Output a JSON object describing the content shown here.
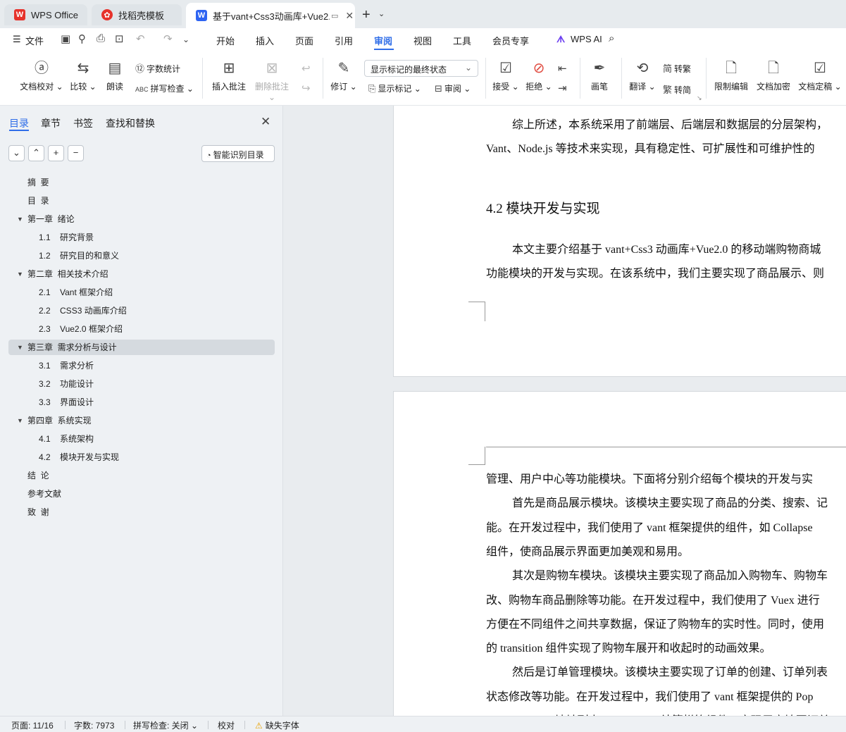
{
  "tabs": [
    {
      "label": "WPS Office",
      "icon": "wps-logo-icon"
    },
    {
      "label": "找稻壳模板",
      "icon": "docer-icon"
    },
    {
      "label": "基于vant+Css3动画库+Vue2.",
      "icon": "writer-doc-icon",
      "active": true
    }
  ],
  "menu": {
    "file": "文件",
    "items": [
      "开始",
      "插入",
      "页面",
      "引用",
      "审阅",
      "视图",
      "工具",
      "会员专享"
    ],
    "active": "审阅",
    "wps_ai": "WPS AI"
  },
  "ribbon": {
    "proofread": "文档校对",
    "compare": "比较",
    "read_aloud": "朗读",
    "word_count": "字数统计",
    "spell_check": "拼写检查",
    "insert_comment": "插入批注",
    "delete_comment": "删除批注",
    "track_changes": "修订",
    "markup_state": "显示标记的最终状态",
    "show_markup": "显示标记",
    "review": "审阅",
    "accept": "接受",
    "reject": "拒绝",
    "pen": "画笔",
    "translate": "翻译",
    "to_traditional": "转繁",
    "to_simplified": "转简",
    "restrict_edit": "限制编辑",
    "encrypt": "文档加密",
    "finalize": "文档定稿"
  },
  "navpane": {
    "tabs": [
      "目录",
      "章节",
      "书签",
      "查找和替换"
    ],
    "active_tab": "目录",
    "smart_toc": "智能识别目录",
    "toc": [
      {
        "text": "摘  要",
        "level": 1,
        "has_children": false
      },
      {
        "text": "目  录",
        "level": 1,
        "has_children": false
      },
      {
        "text": "第一章  绪论",
        "level": 1,
        "has_children": true
      },
      {
        "text": "1.1    研究背景",
        "level": 2
      },
      {
        "text": "1.2    研究目的和意义",
        "level": 2
      },
      {
        "text": "第二章  相关技术介绍",
        "level": 1,
        "has_children": true
      },
      {
        "text": "2.1    Vant 框架介绍",
        "level": 2
      },
      {
        "text": "2.2    CSS3 动画库介绍",
        "level": 2
      },
      {
        "text": "2.3    Vue2.0 框架介绍",
        "level": 2
      },
      {
        "text": "第三章  需求分析与设计",
        "level": 1,
        "has_children": true,
        "selected": true
      },
      {
        "text": "3.1    需求分析",
        "level": 2
      },
      {
        "text": "3.2    功能设计",
        "level": 2
      },
      {
        "text": "3.3    界面设计",
        "level": 2
      },
      {
        "text": "第四章  系统实现",
        "level": 1,
        "has_children": true
      },
      {
        "text": "4.1    系统架构",
        "level": 2
      },
      {
        "text": "4.2    模块开发与实现",
        "level": 2
      },
      {
        "text": "结  论",
        "level": 1,
        "has_children": false
      },
      {
        "text": "参考文献",
        "level": 1,
        "has_children": false
      },
      {
        "text": "致  谢",
        "level": 1,
        "has_children": false
      }
    ]
  },
  "document": {
    "page1": {
      "p1_line1": "综上所述，本系统采用了前端层、后端层和数据层的分层架构，",
      "p1_line2": "Vant、Node.js 等技术来实现，具有稳定性、可扩展性和可维护性的",
      "heading": "4.2    模块开发与实现",
      "p2_line1": "本文主要介绍基于 vant+Css3 动画库+Vue2.0 的移动端购物商城",
      "p2_line2": "功能模块的开发与实现。在该系统中，我们主要实现了商品展示、则"
    },
    "page2": {
      "lines": [
        "管理、用户中心等功能模块。下面将分别介绍每个模块的开发与实",
        "首先是商品展示模块。该模块主要实现了商品的分类、搜索、记",
        "能。在开发过程中，我们使用了 vant 框架提供的组件，如 Collapse",
        "组件，使商品展示界面更加美观和易用。",
        "其次是购物车模块。该模块主要实现了商品加入购物车、购物车",
        "改、购物车商品删除等功能。在开发过程中，我们使用了 Vuex 进行",
        "方便在不同组件之间共享数据，保证了购物车的实时性。同时，使用",
        "的 transition 组件实现了购物车展开和收起时的动画效果。",
        "然后是订单管理模块。该模块主要实现了订单的创建、订单列表",
        "状态修改等功能。在开发过程中，我们使用了 vant 框架提供的 Pop",
        "Address、List 地址列表、Cell、Tag 结算栏等组件，实现用户填写订单"
      ],
      "indented": [
        false,
        true,
        false,
        false,
        true,
        false,
        false,
        false,
        true,
        false,
        false
      ]
    }
  },
  "status": {
    "page": "页面: 11/16",
    "words": "字数: 7973",
    "spell": "拼写检查: 关闭",
    "proof": "校对",
    "missing_font": "缺失字体"
  }
}
